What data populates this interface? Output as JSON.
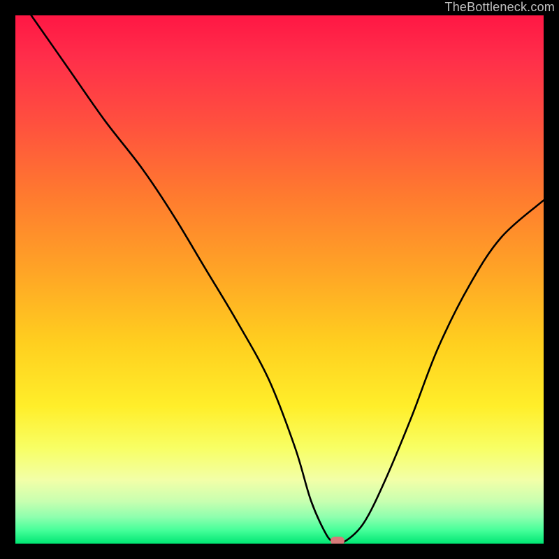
{
  "watermark": "TheBottleneck.com",
  "marker_color": "#d87a7a",
  "chart_data": {
    "type": "line",
    "title": "",
    "xlabel": "",
    "ylabel": "",
    "xlim": [
      0,
      100
    ],
    "ylim": [
      0,
      100
    ],
    "grid": false,
    "legend": false,
    "series": [
      {
        "name": "bottleneck-curve",
        "x": [
          3,
          10,
          17,
          24,
          30,
          36,
          42,
          48,
          53,
          56,
          59,
          60.5,
          62.5,
          66,
          70,
          75,
          80,
          86,
          92,
          100
        ],
        "values": [
          100,
          90,
          80,
          71,
          62,
          52,
          42,
          31,
          18,
          8,
          1.5,
          0.5,
          0.5,
          4,
          12,
          24,
          37,
          49,
          58,
          65
        ]
      }
    ],
    "annotations": [
      {
        "name": "optimal-marker",
        "x": 61,
        "y": 0.5
      }
    ],
    "background_gradient_stops": [
      {
        "pos": 0,
        "color": "#ff1744"
      },
      {
        "pos": 0.2,
        "color": "#ff4f3f"
      },
      {
        "pos": 0.48,
        "color": "#ffa326"
      },
      {
        "pos": 0.74,
        "color": "#ffee2a"
      },
      {
        "pos": 0.92,
        "color": "#c8ffb0"
      },
      {
        "pos": 1.0,
        "color": "#00e673"
      }
    ]
  }
}
